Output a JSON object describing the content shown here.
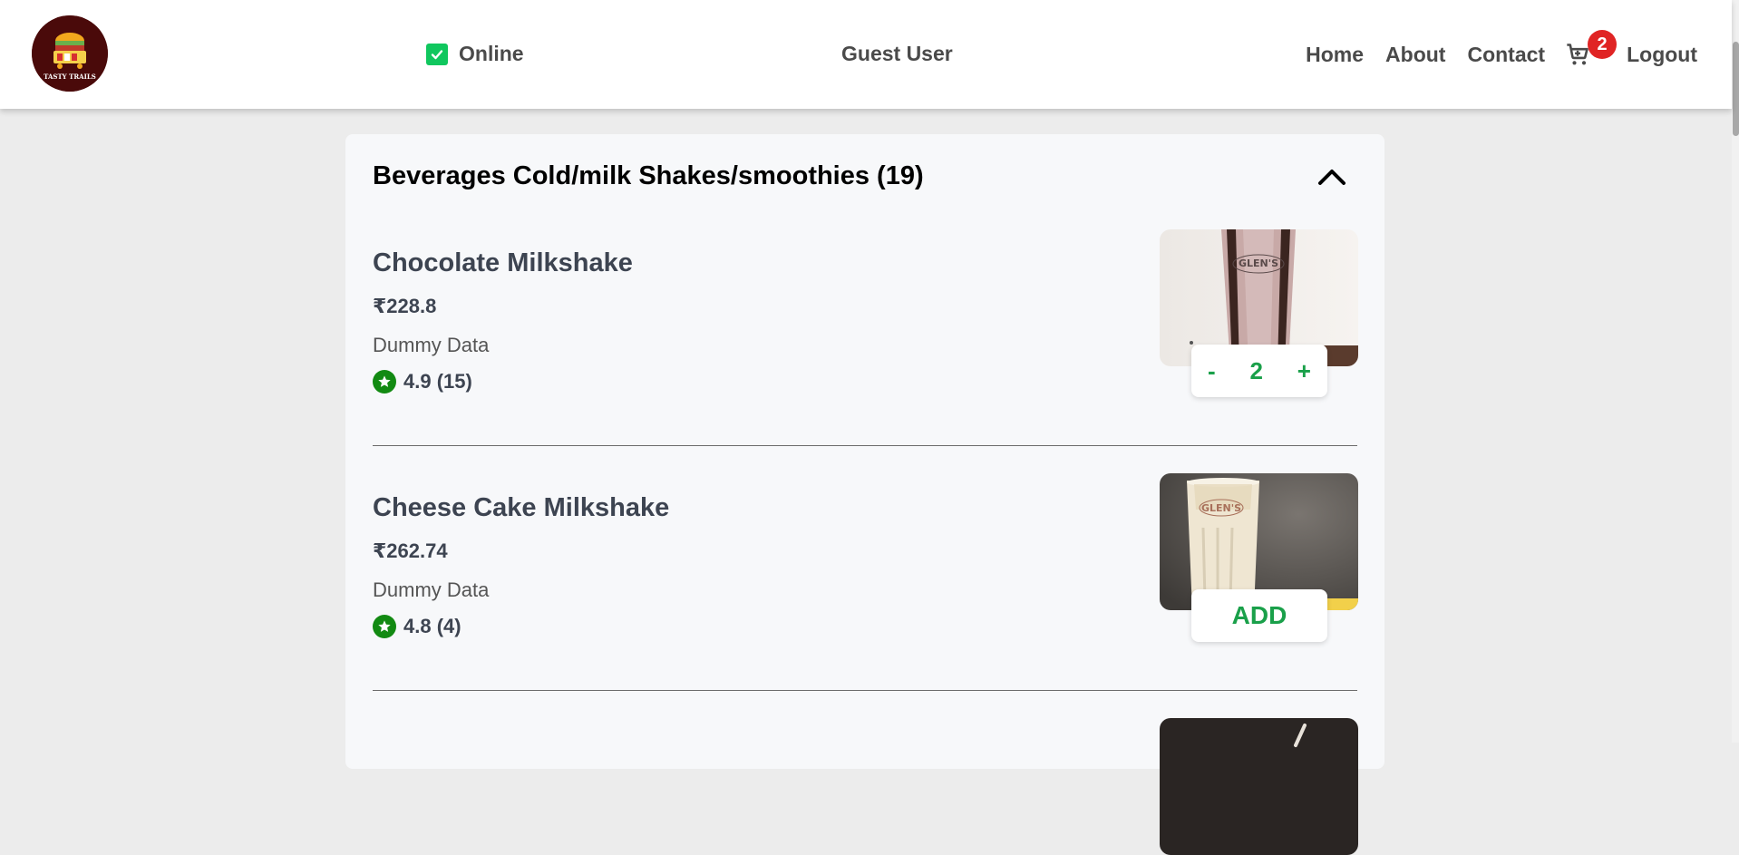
{
  "header": {
    "logo_text": "TASTY TRAILS",
    "status_label": "Online",
    "user_name": "Guest User",
    "nav": {
      "home": "Home",
      "about": "About",
      "contact": "Contact",
      "cart_count": "2",
      "logout": "Logout"
    }
  },
  "category": {
    "title": "Beverages Cold/milk Shakes/smoothies (19)",
    "collapse_icon": "chevron-up-icon",
    "items": [
      {
        "name": "Chocolate Milkshake",
        "price": "₹228.8",
        "description": "Dummy Data",
        "rating": "4.9 (15)",
        "photo_brand": "GLEN'S",
        "quantity": "2",
        "minus": "-",
        "plus": "+"
      },
      {
        "name": "Cheese Cake Milkshake",
        "price": "₹262.74",
        "description": "Dummy Data",
        "rating": "4.8 (4)",
        "photo_brand": "GLEN'S",
        "add_label": "ADD"
      }
    ]
  },
  "colors": {
    "accent_green": "#1aa04a",
    "online_green": "#10c75e",
    "badge_red": "#e02424",
    "rating_green": "#128a12"
  }
}
